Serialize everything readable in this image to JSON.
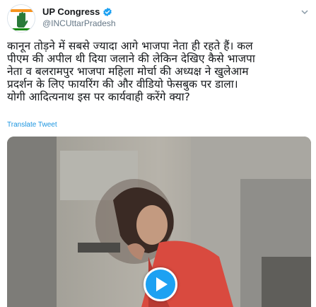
{
  "account": {
    "display_name": "UP Congress",
    "handle": "@INCUttarPradesh",
    "verified": true,
    "avatar_icon": "congress-hand-logo-icon"
  },
  "tweet": {
    "text": "कानून तोड़ने में सबसे ज्यादा आगे भाजपा नेता ही रहते हैं। कल\nपीएम की अपील थी दिया जलाने की लेकिन देखिए कैसे भाजपा\nनेता व बलरामपुर भाजपा महिला मोर्चा की अध्यक्ष ने खुलेआम\nप्रदर्शन के लिए फायरिंग की और वीडियो फेसबुक पर डाला।\nयोगी आदित्यनाथ इस पर कार्यवाही करेंगे क्या?",
    "translate_label": "Translate Tweet"
  },
  "media": {
    "type": "video",
    "play_icon": "play-icon"
  },
  "colors": {
    "link": "#1b95e0",
    "play_button": "#1da1f2",
    "verified": "#1da1f2"
  }
}
